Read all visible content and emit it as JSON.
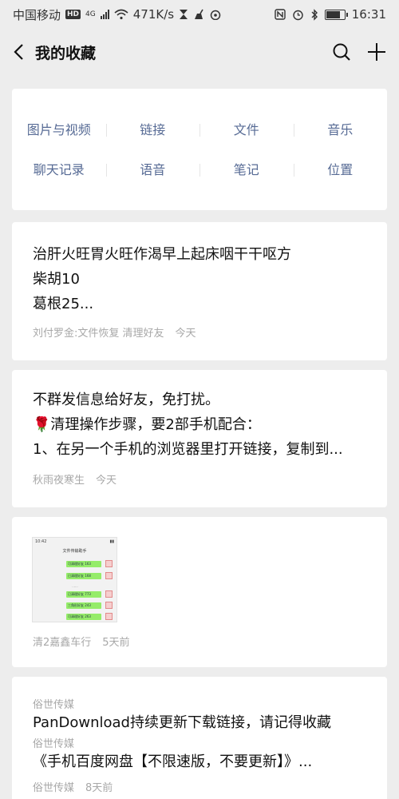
{
  "status_bar": {
    "carrier": "中国移动",
    "hd": "HD",
    "network": "4G",
    "speed": "471K/s",
    "time": "16:31",
    "battery_level": 0.8
  },
  "nav": {
    "title": "我的收藏",
    "back_icon": "back-arrow-icon",
    "search_icon": "search-icon",
    "add_icon": "plus-icon"
  },
  "categories": {
    "row1": [
      "图片与视频",
      "链接",
      "文件",
      "音乐"
    ],
    "row2": [
      "聊天记录",
      "语音",
      "笔记",
      "位置"
    ]
  },
  "items": [
    {
      "lines": [
        "治肝火旺胃火旺作渴早上起床咽干干呕方",
        "柴胡10",
        "葛根25..."
      ],
      "source": "刘付罗金:文件恢复 清理好友",
      "time": "今天"
    },
    {
      "lines": [
        "不群发信息给好友，免打扰。",
        "🌹清理操作步骤，要2部手机配合：",
        "1、在另一个手机的浏览器里打开链接，复制到..."
      ],
      "source": "秋雨夜寒生",
      "time": "今天"
    },
    {
      "thumbnail": {
        "time": "10:42",
        "title": "文件传输助手",
        "bubbles": [
          "可清理好友 163",
          "已清理好友 168",
          "已清理好友 773",
          "三角形好友 243",
          "可清理好友 263"
        ]
      },
      "source": "清2嘉鑫车行",
      "time": "5天前"
    },
    {
      "source1": "俗世传媒",
      "title1": "PanDownload持续更新下载链接，请记得收藏",
      "source2": "俗世传媒",
      "title2": "《手机百度网盘【不限速版，不要更新】》...",
      "source3": "俗世传媒",
      "time": "8天前"
    }
  ]
}
